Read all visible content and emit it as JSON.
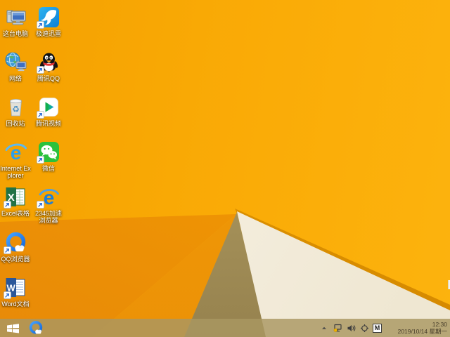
{
  "desktop": {
    "icons": [
      {
        "label": "这台电脑"
      },
      {
        "label": "极速迅雷"
      },
      {
        "label": "网络"
      },
      {
        "label": "腾讯QQ"
      },
      {
        "label": "回收站"
      },
      {
        "label": "腾讯视频"
      },
      {
        "label": "Internet Explorer"
      },
      {
        "label": "微信"
      },
      {
        "label": "Excel表格"
      },
      {
        "label": "2345加速浏览器"
      },
      {
        "label": "QQ浏览器"
      },
      {
        "label": "Word文档"
      }
    ]
  },
  "taskbar": {
    "ime_indicator": "M",
    "clock": {
      "time": "12:30",
      "date": "2019/10/14 星期一"
    }
  },
  "colors": {
    "wallpaper_orange": "#F9A905",
    "wallpaper_deep_orange": "#EE9304",
    "wallpaper_cream": "#F2ECDC",
    "wallpaper_shadow_olive": "#A38F58",
    "edge_highlight": "#D68A00",
    "taskbar_tint": "#AA9761"
  }
}
